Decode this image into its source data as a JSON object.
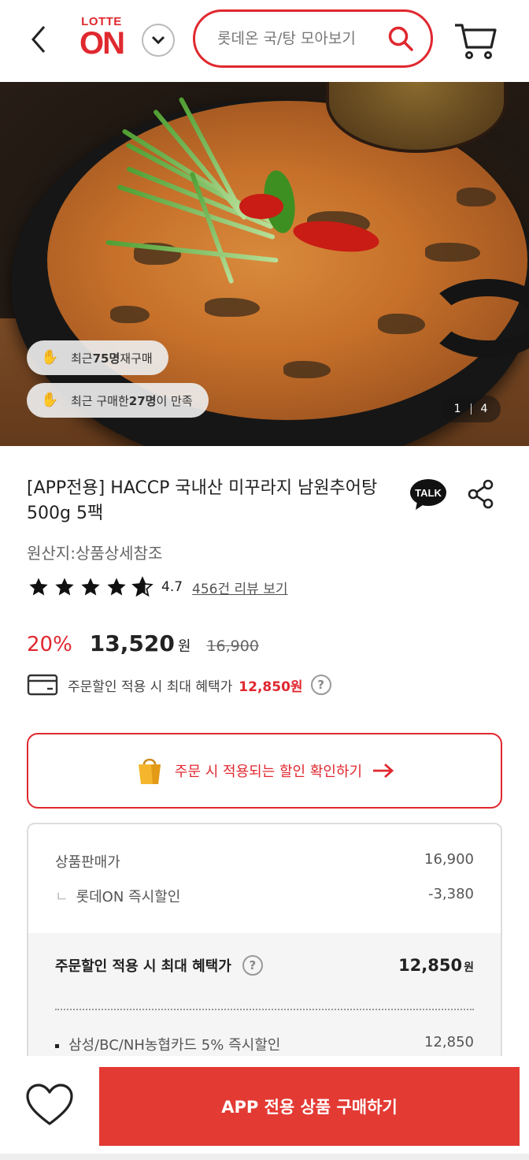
{
  "header": {
    "logo_top": "LOTTE",
    "logo_main": "ON",
    "search_placeholder": "롯데온 국/탕 모아보기"
  },
  "hero": {
    "badge_repurchase": {
      "prefix": "최근 ",
      "count": "75명",
      "suffix": " 재구매"
    },
    "badge_satisfied": {
      "prefix": "최근 구매한 ",
      "count": "27명",
      "suffix": "이 만족"
    },
    "page_current": "1",
    "page_total": "4"
  },
  "product": {
    "title": "[APP전용] HACCP 국내산 미꾸라지 남원추어탕 500g 5팩",
    "talk_label": "TALK",
    "origin": "원산지:상품상세참조",
    "rating": "4.7",
    "rating_stars": 4.7,
    "review_link": "456건 리뷰 보기"
  },
  "price": {
    "discount": "20%",
    "sale": "13,520",
    "won": "원",
    "original": "16,900",
    "benefit_text": "주문할인 적용 시 최대 혜택가",
    "benefit_price": "12,850원",
    "help": "?"
  },
  "coupon": {
    "label": "주문 시 적용되는 할인 확인하기"
  },
  "detail": {
    "sale_label": "상품판매가",
    "sale_value": "16,900",
    "instant_mark": "ㄴ",
    "instant_label": "롯데ON 즉시할인",
    "instant_value": "-3,380",
    "max_label": "주문할인 적용 시 최대 혜택가",
    "max_value": "12,850",
    "max_unit": "원",
    "card_label": "삼성/BC/NH농협카드 5% 즉시할인",
    "card_value": "12,850"
  },
  "bottom": {
    "buy_label": "APP 전용 상품 구매하기"
  },
  "colors": {
    "brand": "#e0282f",
    "buy_button": "#e33a34"
  }
}
